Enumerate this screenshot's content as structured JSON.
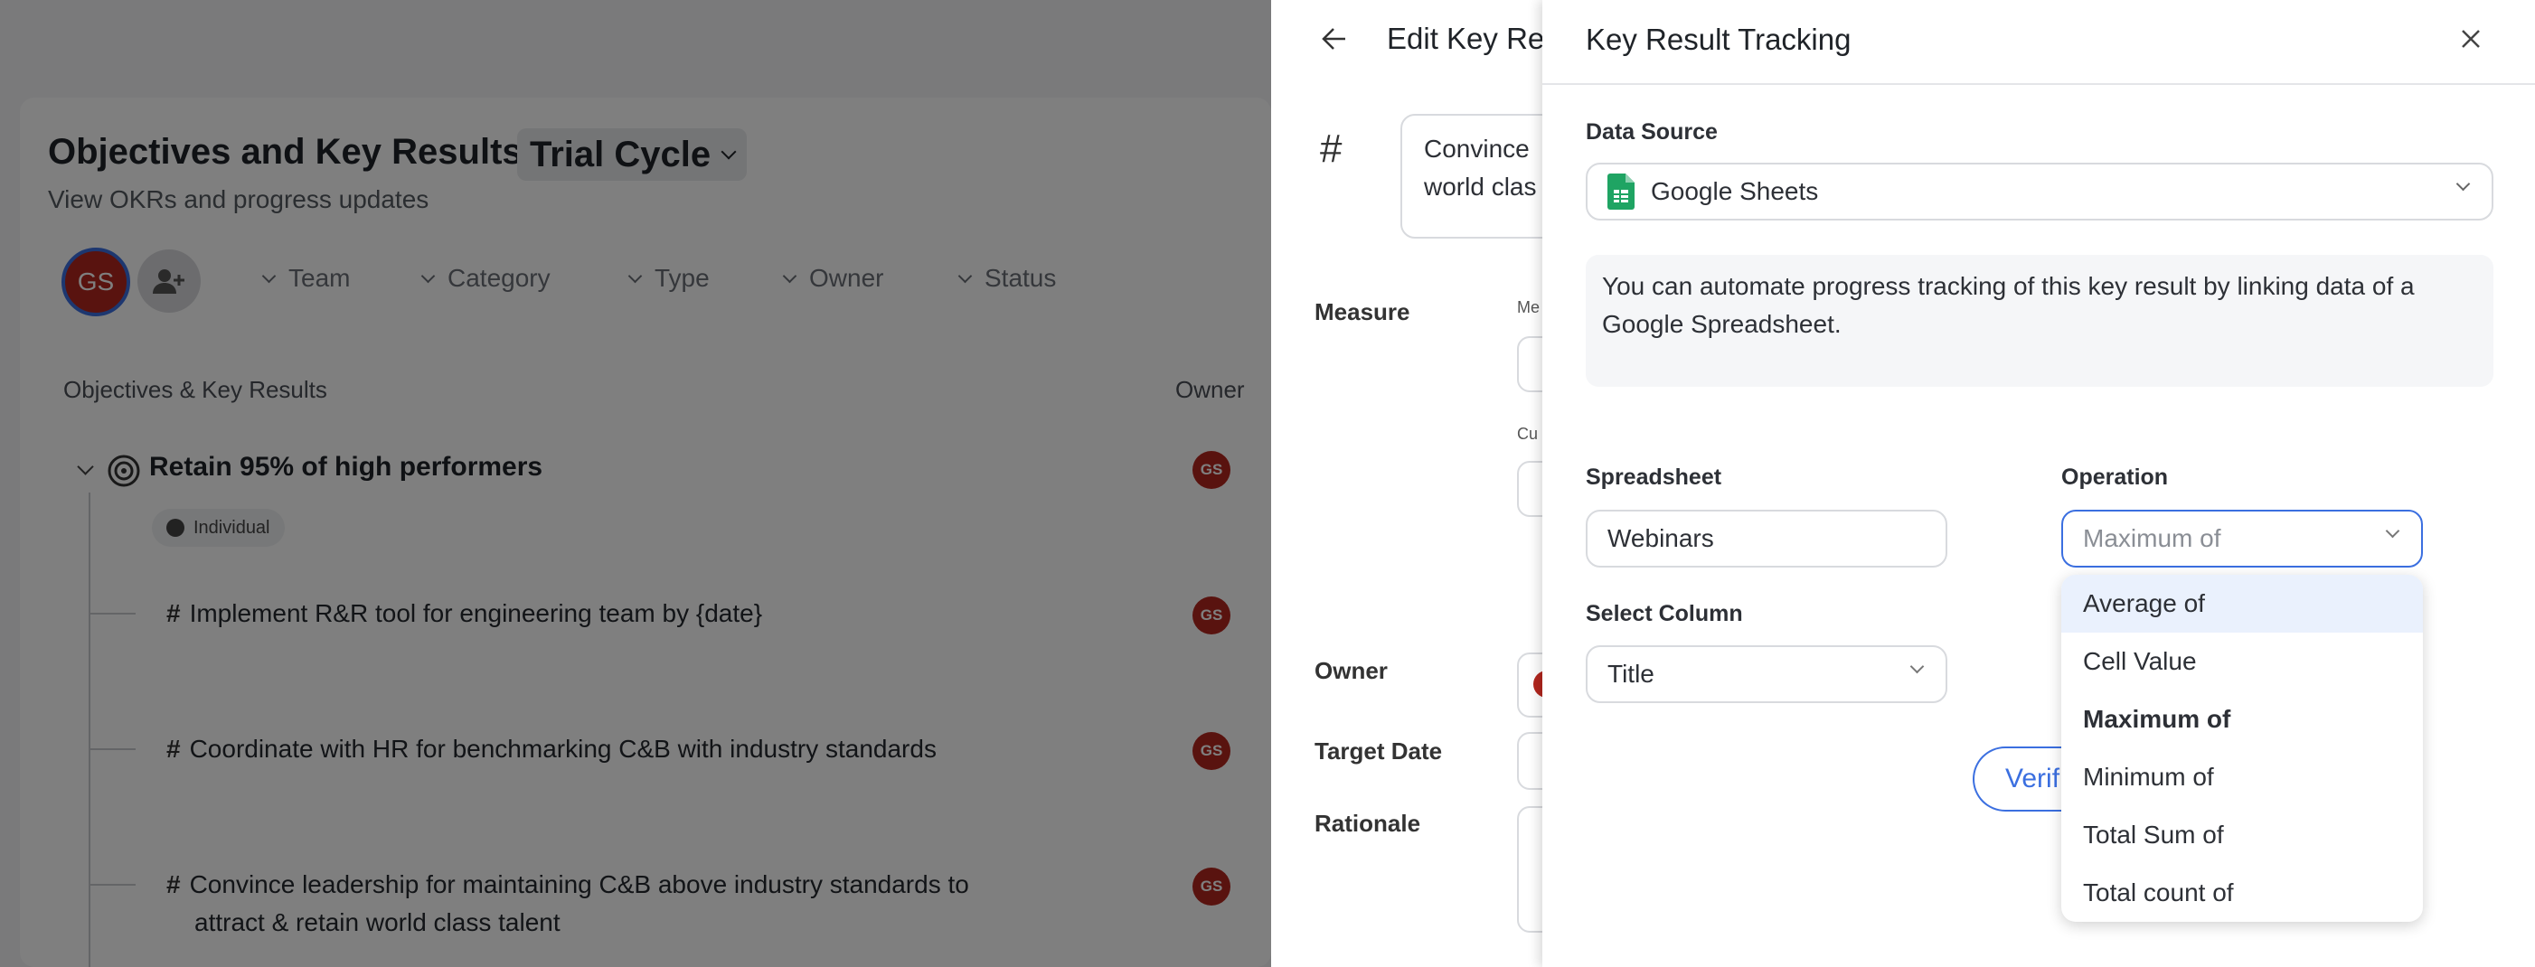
{
  "background": {
    "page_title": "Objectives and Key Results -",
    "cycle_label": "Trial Cycle",
    "subtitle": "View OKRs and progress updates",
    "user_initials": "GS",
    "filters": [
      "Team",
      "Category",
      "Type",
      "Owner",
      "Status"
    ],
    "table_header": {
      "objectives": "Objectives & Key Results",
      "owner": "Owner"
    },
    "objective": {
      "title": "Retain 95% of high performers",
      "tag": "Individual",
      "owner": "GS"
    },
    "key_results": [
      {
        "line1": "Implement R&R tool for engineering team by {date}",
        "line2": "",
        "owner": "GS"
      },
      {
        "line1": "Coordinate with HR for benchmarking C&B with industry standards",
        "line2": "",
        "owner": "GS"
      },
      {
        "line1": "Convince leadership for maintaining C&B above industry standards to",
        "line2": "attract & retain world class talent",
        "owner": "GS"
      }
    ]
  },
  "edit_panel": {
    "title": "Edit Key Res",
    "hash_symbol": "#",
    "text_line1": "Convince",
    "text_line2": "world clas",
    "fields": {
      "measure": "Measure",
      "me": "Me",
      "cu": "Cu",
      "owner": "Owner",
      "target_date": "Target Date",
      "rationale": "Rationale"
    }
  },
  "tracking_panel": {
    "title": "Key Result Tracking",
    "data_source_label": "Data Source",
    "data_source_value": "Google Sheets",
    "info_text_line1": "You can automate progress tracking of this key result by linking data of a",
    "info_text_line2": "Google Spreadsheet.",
    "spreadsheet_label": "Spreadsheet",
    "spreadsheet_value": "Webinars",
    "operation_label": "Operation",
    "operation_placeholder": "Maximum of",
    "select_column_label": "Select Column",
    "select_column_value": "Title",
    "verify_button": "Verif",
    "operation_options": [
      "Average of",
      "Cell Value",
      "Maximum of",
      "Minimum of",
      "Total Sum of",
      "Total count of"
    ],
    "operation_selected": "Maximum of",
    "operation_highlighted": "Average of"
  },
  "colors": {
    "accent": "#3b6fe0",
    "owner_avatar": "#b3261e",
    "sheets_green": "#1fa463"
  }
}
